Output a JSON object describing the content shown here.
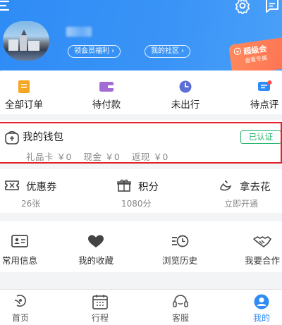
{
  "header": {
    "member_benefits_label": "领会员福利",
    "my_community_label": "我的社区",
    "vip_card": {
      "title": "超级会",
      "subtitle": "查看专属"
    }
  },
  "orders": [
    {
      "label": "全部订单",
      "icon": "orders-icon",
      "color": "#f5a623"
    },
    {
      "label": "待付款",
      "icon": "wallet-pay-icon",
      "color": "#a26bd6"
    },
    {
      "label": "未出行",
      "icon": "clock-icon",
      "color": "#5b6fd6"
    },
    {
      "label": "待点评",
      "icon": "comment-icon",
      "color": "#2f8cf5"
    }
  ],
  "wallet": {
    "title": "我的钱包",
    "verified_label": "已认证",
    "gift_card": "礼品卡 ￥0",
    "cash": "现金 ￥0",
    "cashback": "返现 ￥0"
  },
  "assets": [
    {
      "title": "优惠券",
      "value": "26张",
      "icon": "coupon-icon"
    },
    {
      "title": "积分",
      "value": "1080分",
      "icon": "gift-icon"
    },
    {
      "title": "拿去花",
      "value": "立即开通",
      "icon": "credit-icon"
    }
  ],
  "services": [
    {
      "label": "常用信息",
      "icon": "contact-card-icon"
    },
    {
      "label": "我的收藏",
      "icon": "heart-icon"
    },
    {
      "label": "浏览历史",
      "icon": "history-icon"
    },
    {
      "label": "我要合作",
      "icon": "handshake-icon"
    }
  ],
  "bottom_nav": [
    {
      "label": "首页",
      "icon": "home-icon",
      "active": false
    },
    {
      "label": "行程",
      "icon": "calendar-icon",
      "active": false
    },
    {
      "label": "客服",
      "icon": "headset-icon",
      "active": false
    },
    {
      "label": "我的",
      "icon": "profile-icon",
      "active": true
    }
  ],
  "colors": {
    "brand_blue": "#2f8cf5",
    "verified_green": "#22b26a",
    "highlight_red": "#e2232b"
  }
}
